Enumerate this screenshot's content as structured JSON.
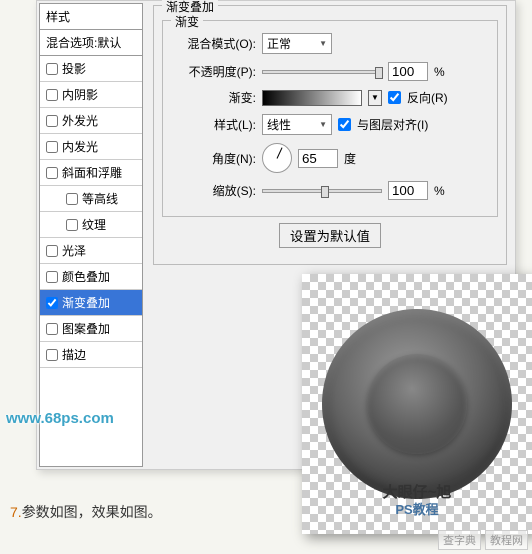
{
  "sidebar": {
    "header": "样式",
    "subtitle": "混合选项:默认",
    "items": [
      {
        "label": "投影",
        "checked": false
      },
      {
        "label": "内阴影",
        "checked": false
      },
      {
        "label": "外发光",
        "checked": false
      },
      {
        "label": "内发光",
        "checked": false
      },
      {
        "label": "斜面和浮雕",
        "checked": false
      },
      {
        "label": "等高线",
        "checked": false,
        "indent": true
      },
      {
        "label": "纹理",
        "checked": false,
        "indent": true
      },
      {
        "label": "光泽",
        "checked": false
      },
      {
        "label": "颜色叠加",
        "checked": false
      },
      {
        "label": "渐变叠加",
        "checked": true,
        "selected": true
      },
      {
        "label": "图案叠加",
        "checked": false
      },
      {
        "label": "描边",
        "checked": false
      }
    ]
  },
  "panel": {
    "group_title": "渐变叠加",
    "inner_title": "渐变",
    "blend_mode_label": "混合模式(O):",
    "blend_mode_value": "正常",
    "opacity_label": "不透明度(P):",
    "opacity_value": "100",
    "opacity_unit": "%",
    "gradient_label": "渐变:",
    "reverse_label": "反向(R)",
    "style_label": "样式(L):",
    "style_value": "线性",
    "align_label": "与图层对齐(I)",
    "angle_label": "角度(N):",
    "angle_value": "65",
    "angle_unit": "度",
    "scale_label": "缩放(S):",
    "scale_value": "100",
    "scale_unit": "%",
    "default_btn": "设置为默认值"
  },
  "watermark": {
    "logo": "大眼仔~旭",
    "sub": "PS教程",
    "url": "www.68ps.com"
  },
  "caption": {
    "num": "7.",
    "text": "参数如图，效果如图。"
  },
  "footer": {
    "a": "查字典",
    "b": "教程网"
  }
}
